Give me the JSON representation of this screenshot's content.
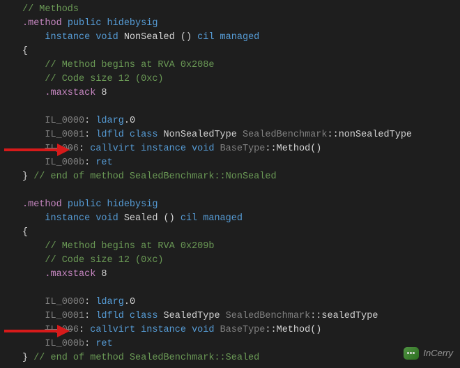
{
  "watermark": "InCerry",
  "lines": [
    [
      [
        "comment",
        "// Methods"
      ]
    ],
    [
      [
        "directive",
        ".method "
      ],
      [
        "keyword",
        "public hidebysig"
      ]
    ],
    [
      [
        "text",
        "    "
      ],
      [
        "keyword",
        "instance void "
      ],
      [
        "white",
        "NonSealed () "
      ],
      [
        "keyword",
        "cil managed"
      ]
    ],
    [
      [
        "white",
        "{"
      ]
    ],
    [
      [
        "text",
        "    "
      ],
      [
        "comment",
        "// Method begins at RVA 0x208e"
      ]
    ],
    [
      [
        "text",
        "    "
      ],
      [
        "comment",
        "// Code size 12 (0xc)"
      ]
    ],
    [
      [
        "text",
        "    "
      ],
      [
        "directive",
        ".maxstack "
      ],
      [
        "white",
        "8"
      ]
    ],
    [
      [
        "text",
        " "
      ]
    ],
    [
      [
        "text",
        "    "
      ],
      [
        "label",
        "IL_0000"
      ],
      [
        "colon",
        ": "
      ],
      [
        "instr",
        "ldarg"
      ],
      [
        "white",
        ".0"
      ]
    ],
    [
      [
        "text",
        "    "
      ],
      [
        "label",
        "IL_0001"
      ],
      [
        "colon",
        ": "
      ],
      [
        "instr",
        "ldfld class "
      ],
      [
        "white",
        "NonSealedType "
      ],
      [
        "type-ref",
        "SealedBenchmark"
      ],
      [
        "white",
        "::nonSealedType"
      ]
    ],
    [
      [
        "text",
        "    "
      ],
      [
        "strike",
        "IL_00"
      ],
      [
        "label",
        "6"
      ],
      [
        "colon",
        ": "
      ],
      [
        "instr",
        "callvirt "
      ],
      [
        "keyword",
        "instance void "
      ],
      [
        "type-ref",
        "BaseType"
      ],
      [
        "white",
        "::Method()"
      ]
    ],
    [
      [
        "text",
        "    "
      ],
      [
        "label",
        "IL_000b"
      ],
      [
        "colon",
        ": "
      ],
      [
        "instr",
        "ret"
      ]
    ],
    [
      [
        "white",
        "} "
      ],
      [
        "comment",
        "// end of method SealedBenchmark::NonSealed"
      ]
    ],
    [
      [
        "text",
        " "
      ]
    ],
    [
      [
        "directive",
        ".method "
      ],
      [
        "keyword",
        "public hidebysig"
      ]
    ],
    [
      [
        "text",
        "    "
      ],
      [
        "keyword",
        "instance void "
      ],
      [
        "white",
        "Sealed () "
      ],
      [
        "keyword",
        "cil managed"
      ]
    ],
    [
      [
        "white",
        "{"
      ]
    ],
    [
      [
        "text",
        "    "
      ],
      [
        "comment",
        "// Method begins at RVA 0x209b"
      ]
    ],
    [
      [
        "text",
        "    "
      ],
      [
        "comment",
        "// Code size 12 (0xc)"
      ]
    ],
    [
      [
        "text",
        "    "
      ],
      [
        "directive",
        ".maxstack "
      ],
      [
        "white",
        "8"
      ]
    ],
    [
      [
        "text",
        " "
      ]
    ],
    [
      [
        "text",
        "    "
      ],
      [
        "label",
        "IL_0000"
      ],
      [
        "colon",
        ": "
      ],
      [
        "instr",
        "ldarg"
      ],
      [
        "white",
        ".0"
      ]
    ],
    [
      [
        "text",
        "    "
      ],
      [
        "label",
        "IL_0001"
      ],
      [
        "colon",
        ": "
      ],
      [
        "instr",
        "ldfld class "
      ],
      [
        "white",
        "SealedType "
      ],
      [
        "type-ref",
        "SealedBenchmark"
      ],
      [
        "white",
        "::sealedType"
      ]
    ],
    [
      [
        "text",
        "    "
      ],
      [
        "strike",
        "IL_00"
      ],
      [
        "label",
        "6"
      ],
      [
        "colon",
        ": "
      ],
      [
        "instr",
        "callvirt "
      ],
      [
        "keyword",
        "instance void "
      ],
      [
        "type-ref",
        "BaseType"
      ],
      [
        "white",
        "::Method()"
      ]
    ],
    [
      [
        "text",
        "    "
      ],
      [
        "label",
        "IL_000b"
      ],
      [
        "colon",
        ": "
      ],
      [
        "instr",
        "ret"
      ]
    ],
    [
      [
        "white",
        "} "
      ],
      [
        "comment",
        "// end of method SealedBenchmark::Sealed"
      ]
    ]
  ],
  "arrows": [
    10,
    23
  ]
}
